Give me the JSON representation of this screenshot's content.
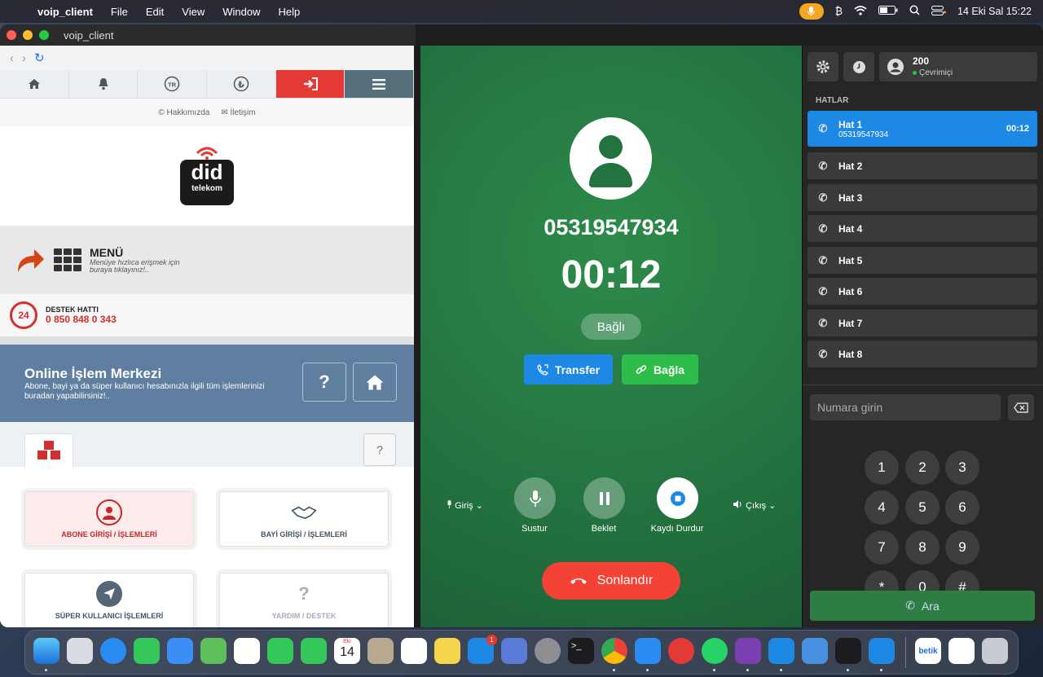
{
  "menubar": {
    "app_name": "voip_client",
    "menus": [
      "File",
      "Edit",
      "View",
      "Window",
      "Help"
    ],
    "date_time": "14 Eki Sal  15:22"
  },
  "window": {
    "title": "voip_client"
  },
  "web": {
    "links": [
      "Hakkımızda",
      "İletişim"
    ],
    "logo_text": "did",
    "logo_sub": "telekom",
    "menu_title": "MENÜ",
    "menu_sub1": "Menüye hızlıca erişmek için",
    "menu_sub2": "buraya tıklayınız!..",
    "support_label": "DESTEK HATTI",
    "support_number": "0 850 848 0 343",
    "support_badge": "24",
    "olm_title": "Online İşlem Merkezi",
    "olm_desc1": "Abone, bayi ya da süper kullanıcı hesabınızla ilgili tüm işlemlerinizi",
    "olm_desc2": "buradan yapabilirsiniz!..",
    "cards": [
      "ABONE GİRİŞİ / İŞLEMLERİ",
      "BAYİ GİRİŞİ / İŞLEMLERİ",
      "SÜPER KULLANICI İŞLEMLERİ",
      "YARDIM / DESTEK"
    ]
  },
  "call": {
    "number": "05319547934",
    "timer": "00:12",
    "status": "Bağlı",
    "transfer_label": "Transfer",
    "connect_label": "Bağla",
    "input_label": "Giriş",
    "output_label": "Çıkış",
    "mute_label": "Sustur",
    "hold_label": "Beklet",
    "record_label": "Kaydı Durdur",
    "end_label": "Sonlandır"
  },
  "panel": {
    "user_ext": "200",
    "user_status": "Çevrimiçi",
    "lines_header": "HATLAR",
    "lines": [
      {
        "label": "Hat 1",
        "number": "05319547934",
        "timer": "00:12"
      },
      {
        "label": "Hat 2"
      },
      {
        "label": "Hat 3"
      },
      {
        "label": "Hat 4"
      },
      {
        "label": "Hat 5"
      },
      {
        "label": "Hat 6"
      },
      {
        "label": "Hat 7"
      },
      {
        "label": "Hat 8"
      }
    ],
    "number_placeholder": "Numara girin",
    "keys": [
      "1",
      "2",
      "3",
      "4",
      "5",
      "6",
      "7",
      "8",
      "9",
      "*",
      "0",
      "#"
    ],
    "call_label": "Ara"
  },
  "dock": {
    "calendar_month": "Eki",
    "calendar_day": "14",
    "appstore_badge": "1",
    "betik_label": "betik"
  },
  "colors": {
    "accent_blue": "#1e88e5",
    "call_green": "#237340",
    "end_red": "#f44336",
    "connect_green": "#2ebd4a"
  }
}
